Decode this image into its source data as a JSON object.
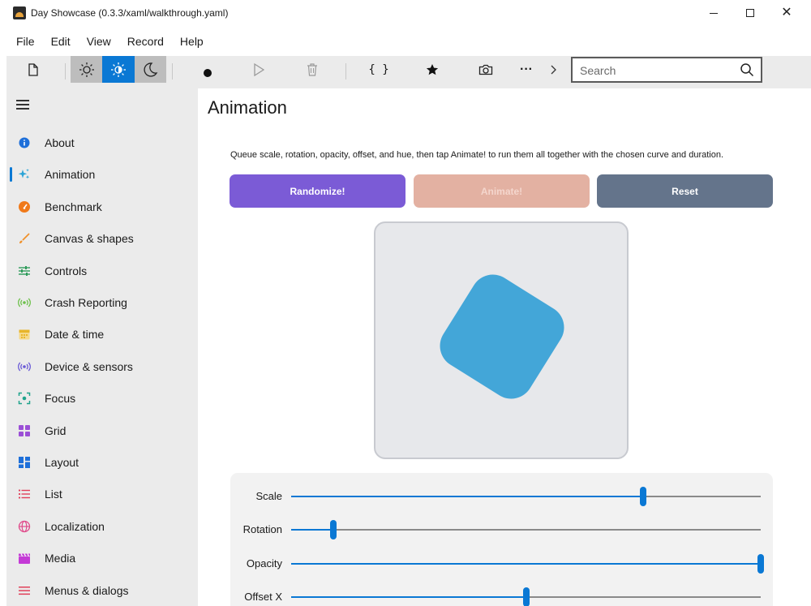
{
  "window": {
    "title": "Day Showcase (0.3.3/xaml/walkthrough.yaml)",
    "minimize_icon": "minimize-icon",
    "maximize_icon": "maximize-icon",
    "close_glyph": "✕"
  },
  "menu": [
    "File",
    "Edit",
    "View",
    "Record",
    "Help"
  ],
  "toolbar": {
    "icons": [
      "document-icon",
      "sun-icon",
      "contrast-icon",
      "moon-icon",
      "record-dot-icon",
      "play-icon",
      "trash-icon",
      "braces-icon",
      "star-icon",
      "camera-icon",
      "more-icon",
      "chevron-right-icon"
    ],
    "braces_text": "{ }",
    "more_text": "···",
    "active_theme": "contrast",
    "search_placeholder": "Search"
  },
  "sidebar": {
    "items": [
      {
        "label": "About",
        "icon": "info-icon",
        "color": "#1e6fd9"
      },
      {
        "label": "Animation",
        "icon": "sparkle-icon",
        "color": "#2aa3d6",
        "selected": true
      },
      {
        "label": "Benchmark",
        "icon": "speedometer-icon",
        "color": "#f07a1a"
      },
      {
        "label": "Canvas & shapes",
        "icon": "brush-icon",
        "color": "#f0902a"
      },
      {
        "label": "Controls",
        "icon": "sliders-icon",
        "color": "#2e9b5a"
      },
      {
        "label": "Crash Reporting",
        "icon": "broadcast-icon",
        "color": "#6cc04a"
      },
      {
        "label": "Date & time",
        "icon": "calendar-icon",
        "color": "#e8b52a"
      },
      {
        "label": "Device & sensors",
        "icon": "sensor-icon",
        "color": "#6a5ad6"
      },
      {
        "label": "Focus",
        "icon": "focus-icon",
        "color": "#1fa38c"
      },
      {
        "label": "Grid",
        "icon": "grid-icon",
        "color": "#9b4fd6"
      },
      {
        "label": "Layout",
        "icon": "layout-icon",
        "color": "#1e6fd9"
      },
      {
        "label": "List",
        "icon": "list-icon",
        "color": "#e0405a"
      },
      {
        "label": "Localization",
        "icon": "globe-icon",
        "color": "#e04a8a"
      },
      {
        "label": "Media",
        "icon": "clapper-icon",
        "color": "#c43ad6"
      },
      {
        "label": "Menus & dialogs",
        "icon": "menu-icon",
        "color": "#e0405a"
      }
    ]
  },
  "main": {
    "title": "Animation",
    "description": "Queue scale, rotation, opacity, offset, and hue, then tap Animate! to run them all together with the chosen curve and duration.",
    "buttons": {
      "randomize": "Randomize!",
      "animate": "Animate!",
      "reset": "Reset"
    },
    "sliders": [
      {
        "label": "Scale",
        "value": 0.75
      },
      {
        "label": "Rotation",
        "value": 0.09
      },
      {
        "label": "Opacity",
        "value": 1.0
      },
      {
        "label": "Offset X",
        "value": 0.5
      }
    ]
  }
}
